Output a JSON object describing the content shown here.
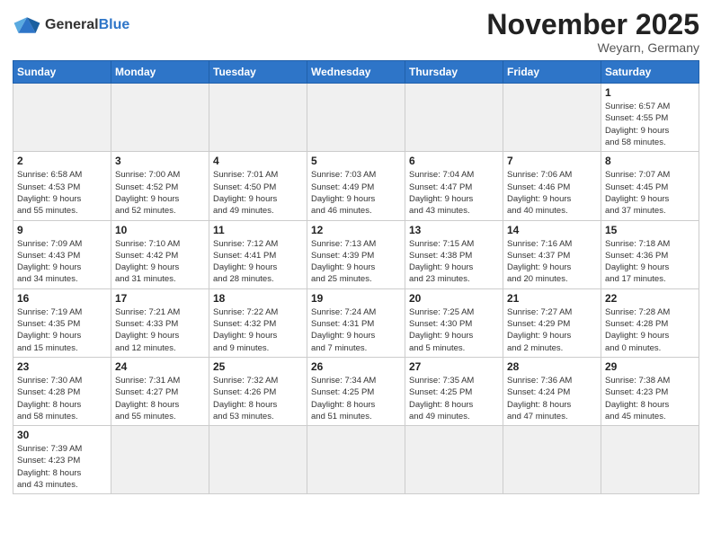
{
  "logo": {
    "text_general": "General",
    "text_blue": "Blue"
  },
  "title": "November 2025",
  "location": "Weyarn, Germany",
  "weekdays": [
    "Sunday",
    "Monday",
    "Tuesday",
    "Wednesday",
    "Thursday",
    "Friday",
    "Saturday"
  ],
  "weeks": [
    [
      {
        "day": "",
        "info": ""
      },
      {
        "day": "",
        "info": ""
      },
      {
        "day": "",
        "info": ""
      },
      {
        "day": "",
        "info": ""
      },
      {
        "day": "",
        "info": ""
      },
      {
        "day": "",
        "info": ""
      },
      {
        "day": "1",
        "info": "Sunrise: 6:57 AM\nSunset: 4:55 PM\nDaylight: 9 hours\nand 58 minutes."
      }
    ],
    [
      {
        "day": "2",
        "info": "Sunrise: 6:58 AM\nSunset: 4:53 PM\nDaylight: 9 hours\nand 55 minutes."
      },
      {
        "day": "3",
        "info": "Sunrise: 7:00 AM\nSunset: 4:52 PM\nDaylight: 9 hours\nand 52 minutes."
      },
      {
        "day": "4",
        "info": "Sunrise: 7:01 AM\nSunset: 4:50 PM\nDaylight: 9 hours\nand 49 minutes."
      },
      {
        "day": "5",
        "info": "Sunrise: 7:03 AM\nSunset: 4:49 PM\nDaylight: 9 hours\nand 46 minutes."
      },
      {
        "day": "6",
        "info": "Sunrise: 7:04 AM\nSunset: 4:47 PM\nDaylight: 9 hours\nand 43 minutes."
      },
      {
        "day": "7",
        "info": "Sunrise: 7:06 AM\nSunset: 4:46 PM\nDaylight: 9 hours\nand 40 minutes."
      },
      {
        "day": "8",
        "info": "Sunrise: 7:07 AM\nSunset: 4:45 PM\nDaylight: 9 hours\nand 37 minutes."
      }
    ],
    [
      {
        "day": "9",
        "info": "Sunrise: 7:09 AM\nSunset: 4:43 PM\nDaylight: 9 hours\nand 34 minutes."
      },
      {
        "day": "10",
        "info": "Sunrise: 7:10 AM\nSunset: 4:42 PM\nDaylight: 9 hours\nand 31 minutes."
      },
      {
        "day": "11",
        "info": "Sunrise: 7:12 AM\nSunset: 4:41 PM\nDaylight: 9 hours\nand 28 minutes."
      },
      {
        "day": "12",
        "info": "Sunrise: 7:13 AM\nSunset: 4:39 PM\nDaylight: 9 hours\nand 25 minutes."
      },
      {
        "day": "13",
        "info": "Sunrise: 7:15 AM\nSunset: 4:38 PM\nDaylight: 9 hours\nand 23 minutes."
      },
      {
        "day": "14",
        "info": "Sunrise: 7:16 AM\nSunset: 4:37 PM\nDaylight: 9 hours\nand 20 minutes."
      },
      {
        "day": "15",
        "info": "Sunrise: 7:18 AM\nSunset: 4:36 PM\nDaylight: 9 hours\nand 17 minutes."
      }
    ],
    [
      {
        "day": "16",
        "info": "Sunrise: 7:19 AM\nSunset: 4:35 PM\nDaylight: 9 hours\nand 15 minutes."
      },
      {
        "day": "17",
        "info": "Sunrise: 7:21 AM\nSunset: 4:33 PM\nDaylight: 9 hours\nand 12 minutes."
      },
      {
        "day": "18",
        "info": "Sunrise: 7:22 AM\nSunset: 4:32 PM\nDaylight: 9 hours\nand 9 minutes."
      },
      {
        "day": "19",
        "info": "Sunrise: 7:24 AM\nSunset: 4:31 PM\nDaylight: 9 hours\nand 7 minutes."
      },
      {
        "day": "20",
        "info": "Sunrise: 7:25 AM\nSunset: 4:30 PM\nDaylight: 9 hours\nand 5 minutes."
      },
      {
        "day": "21",
        "info": "Sunrise: 7:27 AM\nSunset: 4:29 PM\nDaylight: 9 hours\nand 2 minutes."
      },
      {
        "day": "22",
        "info": "Sunrise: 7:28 AM\nSunset: 4:28 PM\nDaylight: 9 hours\nand 0 minutes."
      }
    ],
    [
      {
        "day": "23",
        "info": "Sunrise: 7:30 AM\nSunset: 4:28 PM\nDaylight: 8 hours\nand 58 minutes."
      },
      {
        "day": "24",
        "info": "Sunrise: 7:31 AM\nSunset: 4:27 PM\nDaylight: 8 hours\nand 55 minutes."
      },
      {
        "day": "25",
        "info": "Sunrise: 7:32 AM\nSunset: 4:26 PM\nDaylight: 8 hours\nand 53 minutes."
      },
      {
        "day": "26",
        "info": "Sunrise: 7:34 AM\nSunset: 4:25 PM\nDaylight: 8 hours\nand 51 minutes."
      },
      {
        "day": "27",
        "info": "Sunrise: 7:35 AM\nSunset: 4:25 PM\nDaylight: 8 hours\nand 49 minutes."
      },
      {
        "day": "28",
        "info": "Sunrise: 7:36 AM\nSunset: 4:24 PM\nDaylight: 8 hours\nand 47 minutes."
      },
      {
        "day": "29",
        "info": "Sunrise: 7:38 AM\nSunset: 4:23 PM\nDaylight: 8 hours\nand 45 minutes."
      }
    ],
    [
      {
        "day": "30",
        "info": "Sunrise: 7:39 AM\nSunset: 4:23 PM\nDaylight: 8 hours\nand 43 minutes."
      },
      {
        "day": "",
        "info": ""
      },
      {
        "day": "",
        "info": ""
      },
      {
        "day": "",
        "info": ""
      },
      {
        "day": "",
        "info": ""
      },
      {
        "day": "",
        "info": ""
      },
      {
        "day": "",
        "info": ""
      }
    ]
  ]
}
